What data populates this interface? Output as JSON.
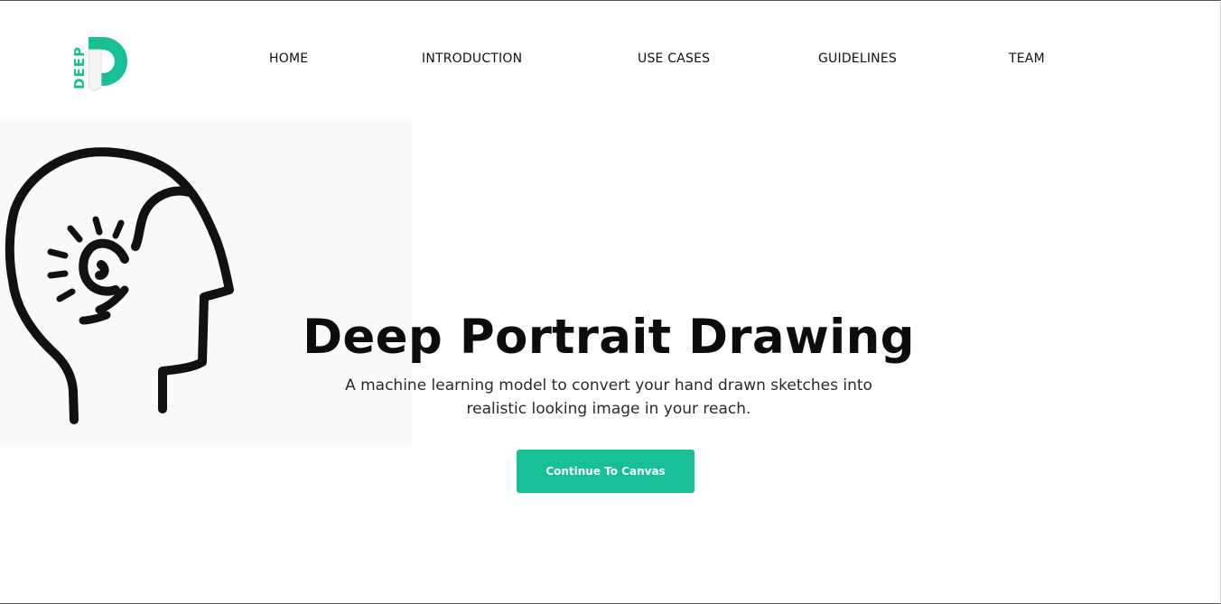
{
  "brand": {
    "logo_text": "DEEP",
    "accent_color": "#17bf96"
  },
  "nav": {
    "items": [
      {
        "label": "HOME"
      },
      {
        "label": "INTRODUCTION"
      },
      {
        "label": "USE CASES"
      },
      {
        "label": "GUIDELINES"
      },
      {
        "label": "TEAM"
      }
    ]
  },
  "hero": {
    "illustration": "head-profile-idea-icon",
    "title": "Deep Portrait Drawing",
    "subtitle": "A machine learning model to convert your hand drawn sketches into realistic looking image in your reach.",
    "cta_label": "Continue To Canvas"
  }
}
